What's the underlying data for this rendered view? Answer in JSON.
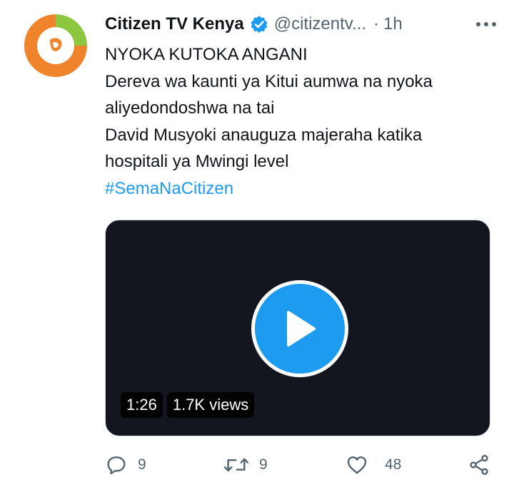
{
  "tweet": {
    "author_name": "Citizen TV Kenya",
    "handle": "@citizentv...",
    "separator": "·",
    "time": "1h",
    "lines": [
      "NYOKA KUTOKA ANGANI",
      "Dereva wa kaunti ya Kitui aumwa na nyoka",
      "aliyedondoshwa na tai",
      "David Musyoki anauguza majeraha katika",
      "hospitali ya Mwingi level"
    ],
    "hashtag": "#SemaNaCitizen"
  },
  "video": {
    "duration": "1:26",
    "views": "1.7K views"
  },
  "actions": {
    "replies": "9",
    "retweets": "9",
    "likes": "48"
  },
  "icons": {
    "avatar": "citizen-tv-logo",
    "verified": "verified-badge-icon",
    "more": "more-horizontal-icon",
    "play": "play-icon",
    "reply": "reply-icon",
    "retweet": "retweet-icon",
    "like": "heart-icon",
    "share": "share-icon"
  },
  "colors": {
    "accent": "#1d9bf0",
    "logo_orange": "#f0842c",
    "logo_green": "#8dc63f",
    "video_bg": "#14161f"
  }
}
